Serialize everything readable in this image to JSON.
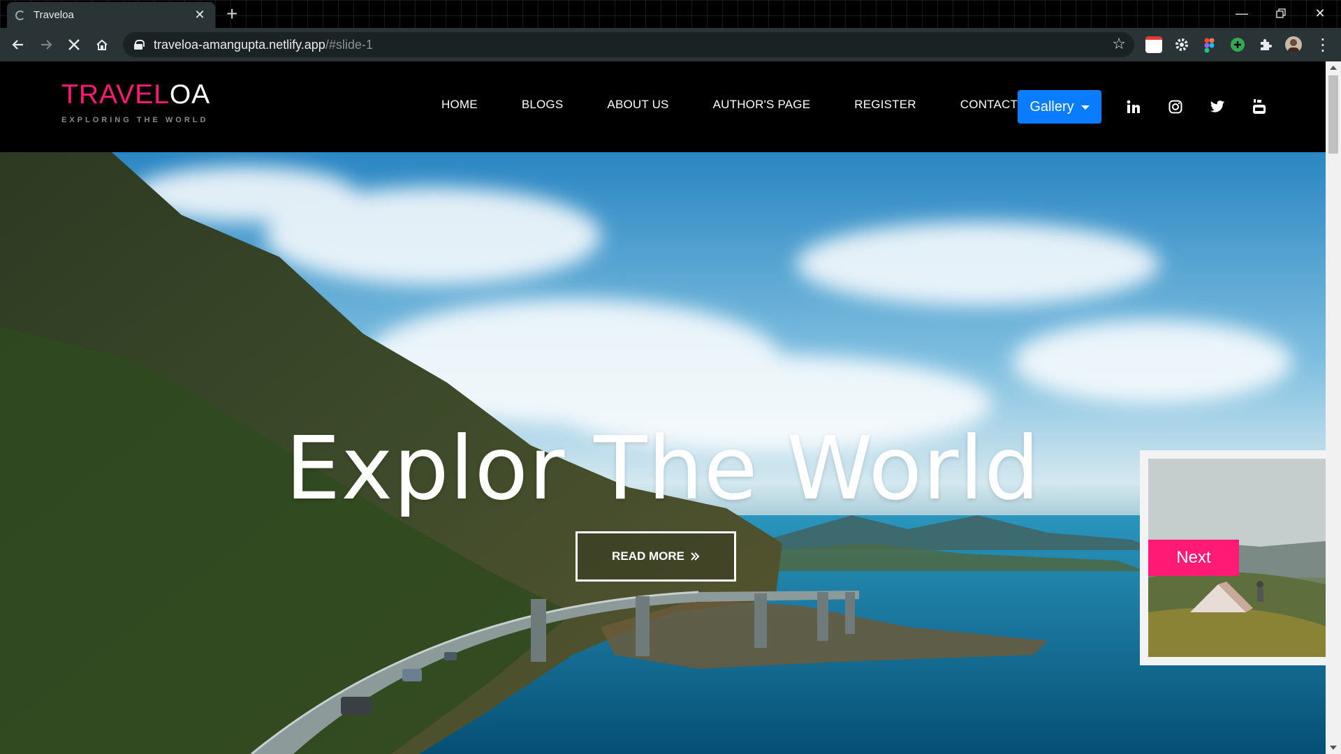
{
  "browser": {
    "tab_title": "Traveloa",
    "url_host": "traveloa-amangupta.netlify.app",
    "url_path": "/#slide-1"
  },
  "site": {
    "logo_part1": "TRAVEL",
    "logo_part2": "OA",
    "tagline": "EXPLORING THE WORLD",
    "nav": {
      "home": "HOME",
      "blogs": "BLOGS",
      "about": "ABOUT US",
      "author": "AUTHOR'S PAGE",
      "register": "REGISTER",
      "contact": "CONTACT",
      "gallery": "Gallery"
    },
    "social_icons": [
      "linkedin-icon",
      "instagram-icon",
      "twitter-icon",
      "youtube-icon"
    ]
  },
  "hero": {
    "headline": "Explor The World",
    "read_more": "READ MORE",
    "next_label": "Next"
  },
  "colors": {
    "brand_pink": "#ff1a75",
    "gallery_blue": "#0a7cff",
    "chrome_bg": "#2a3436"
  }
}
